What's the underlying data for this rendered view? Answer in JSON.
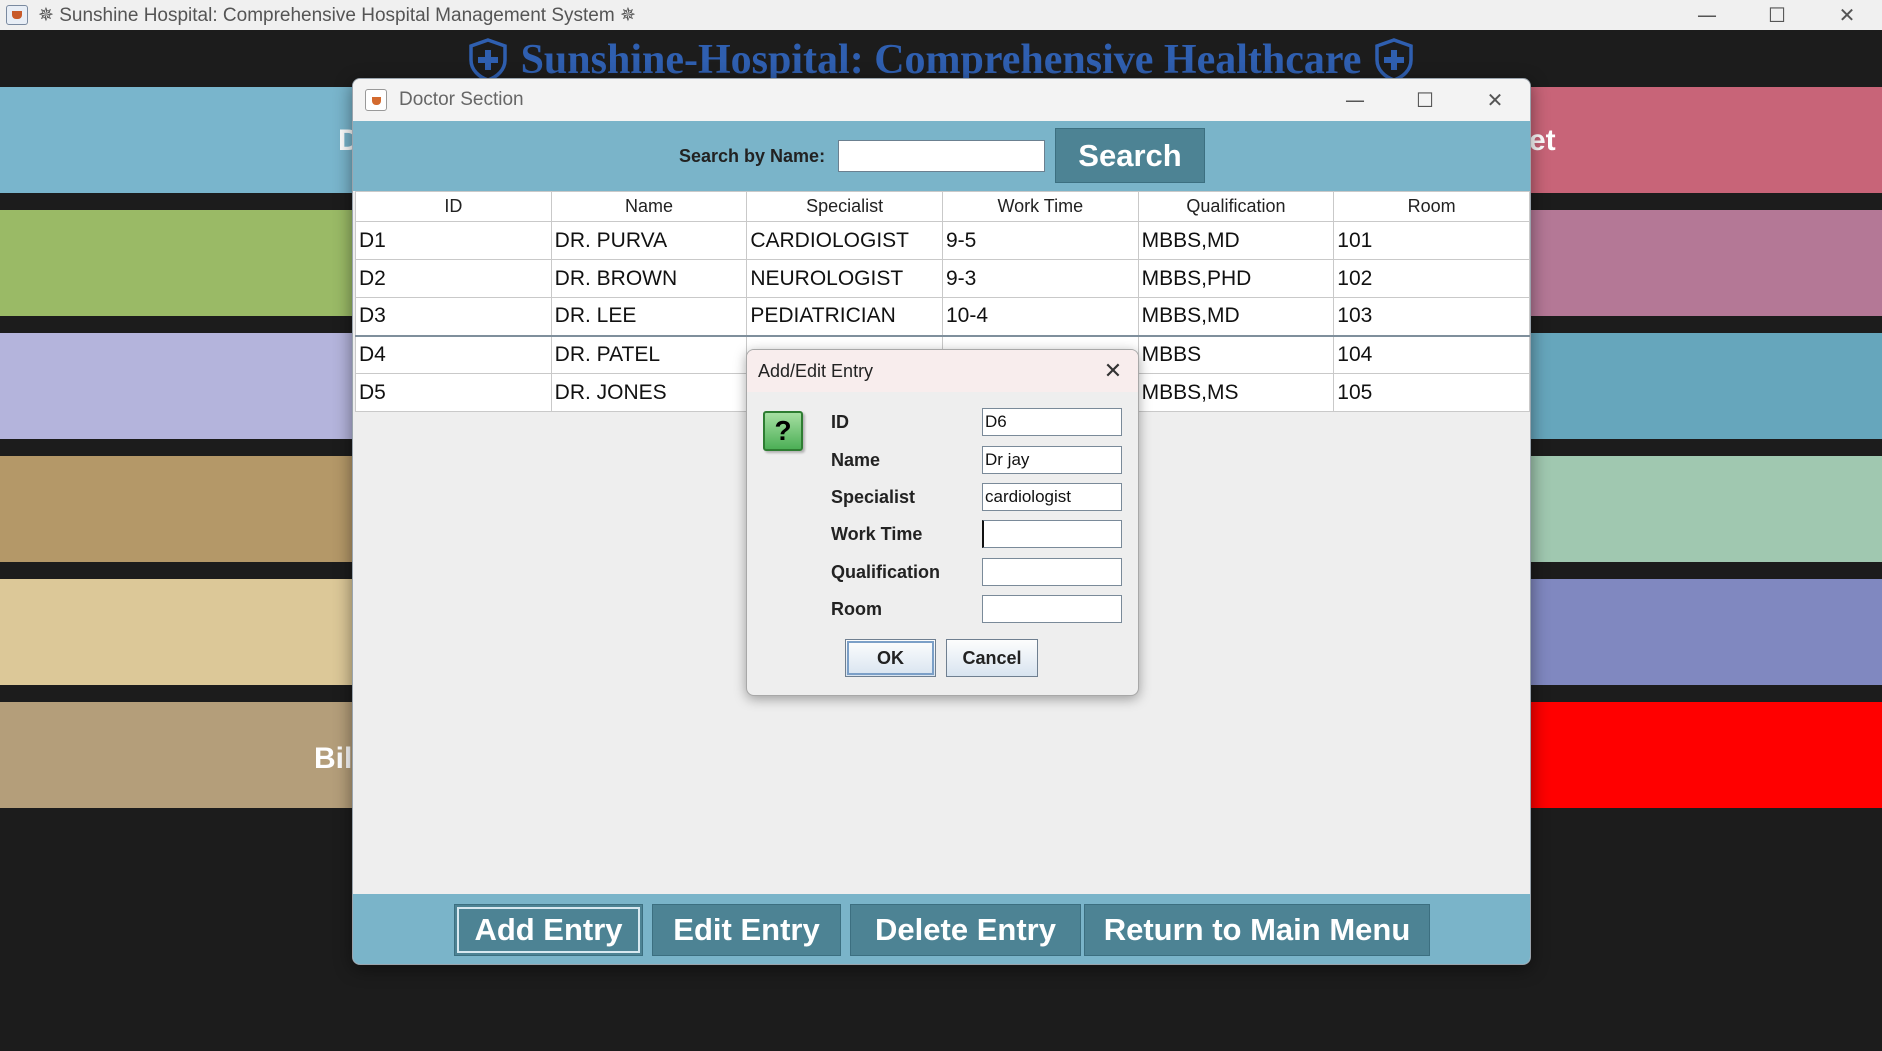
{
  "window": {
    "title": "✵ Sunshine Hospital: Comprehensive Hospital Management System ✵",
    "controls": {
      "minimize": "—",
      "maximize": "☐",
      "close": "✕"
    }
  },
  "background": {
    "header_title": "Sunshine-Hospital: Comprehensive Healthcare",
    "left_tile_label_1": "D",
    "left_tile_label_6": "Bil",
    "right_tile_label_1": "et",
    "left_tile_colors": [
      "#79b5cc",
      "#9aba66",
      "#b4b4dc",
      "#b49868",
      "#dcc898",
      "#b49e7a"
    ],
    "right_tile_colors": [
      "#c86478",
      "#b47896",
      "#66a6bc",
      "#a0c8b0",
      "#8088c0",
      "#ff0000"
    ]
  },
  "doctor_window": {
    "title": "Doctor Section",
    "search_label": "Search by Name:",
    "search_value": "",
    "search_button": "Search",
    "table": {
      "columns": [
        "ID",
        "Name",
        "Specialist",
        "Work Time",
        "Qualification",
        "Room"
      ],
      "rows": [
        [
          "D1",
          "DR. PURVA",
          "CARDIOLOGIST",
          "9-5",
          "MBBS,MD",
          "101"
        ],
        [
          "D2",
          "DR. BROWN",
          "NEUROLOGIST",
          "9-3",
          "MBBS,PHD",
          "102"
        ],
        [
          "D3",
          "DR. LEE",
          "PEDIATRICIAN",
          "10-4",
          "MBBS,MD",
          "103"
        ],
        [
          "D4",
          "DR. PATEL",
          "",
          "",
          "MBBS",
          "104"
        ],
        [
          "D5",
          "DR. JONES",
          "",
          "",
          "MBBS,MS",
          "105"
        ]
      ]
    },
    "buttons": {
      "add": "Add Entry",
      "edit": "Edit Entry",
      "delete": "Delete Entry",
      "return": "Return to Main Menu"
    }
  },
  "dialog": {
    "title": "Add/Edit Entry",
    "icon": "?",
    "fields": [
      {
        "label": "ID",
        "value": "D6"
      },
      {
        "label": "Name",
        "value": "Dr jay"
      },
      {
        "label": "Specialist",
        "value": "cardiologist"
      },
      {
        "label": "Work Time",
        "value": ""
      },
      {
        "label": "Qualification",
        "value": ""
      },
      {
        "label": "Room",
        "value": ""
      }
    ],
    "ok": "OK",
    "cancel": "Cancel"
  },
  "colors": {
    "panel_accent": "#7ab4c9",
    "button_fill": "#4d8394",
    "header_text": "#2f5fb0"
  }
}
